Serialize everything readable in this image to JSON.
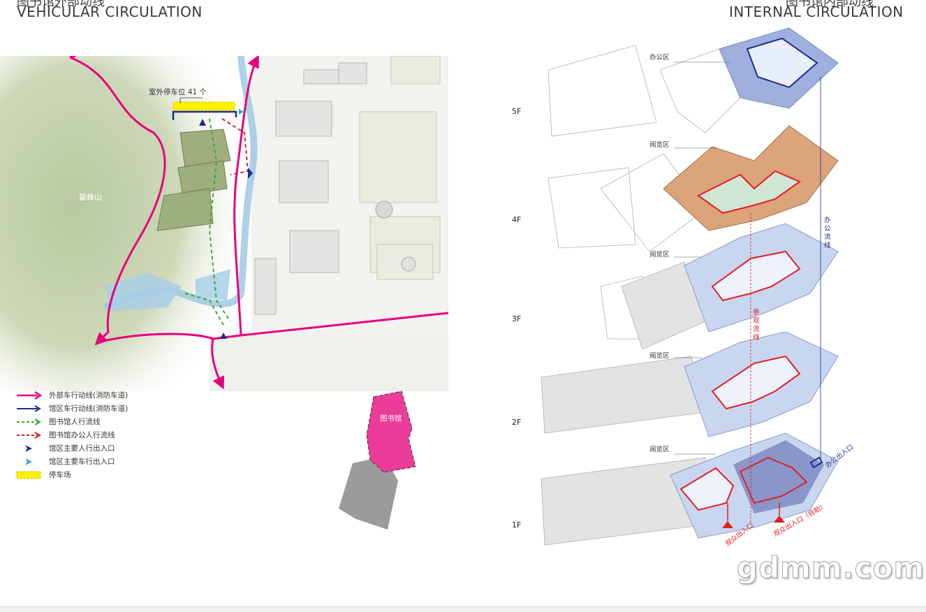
{
  "left_title": {
    "cn": "图书馆外部动线",
    "en": "VEHICULAR CIRCULATION"
  },
  "right_title": {
    "cn": "图书馆内部动线",
    "en": "INTERNAL CIRCULATION"
  },
  "site": {
    "parking_label": "室外停车位 41 个",
    "mountain_label": "鳌峰山"
  },
  "legend": [
    {
      "label": "外部车行动线(消防车道)",
      "icon": "magenta-arrow-line-icon",
      "color": "#e6007e"
    },
    {
      "label": "馆区车行动线(消防车道)",
      "icon": "navy-arrow-line-icon",
      "color": "#1d2f8a"
    },
    {
      "label": "图书馆人行流线",
      "icon": "green-dashed-arrow-icon",
      "color": "#3aa935"
    },
    {
      "label": "图书馆办公人行流线",
      "icon": "red-dashed-arrow-icon",
      "color": "#e02020"
    },
    {
      "label": "馆区主要人行出入口",
      "icon": "navy-entrance-arrow-icon",
      "color": "#1d2f8a"
    },
    {
      "label": "馆区主要车行出入口",
      "icon": "cyan-entrance-arrow-icon",
      "color": "#29a8e0"
    },
    {
      "label": "停车场",
      "icon": "yellow-parking-swatch-icon",
      "color": "#fff200"
    }
  ],
  "key_plan_label": "图书馆",
  "floors": [
    "5F",
    "4F",
    "3F",
    "2F",
    "1F"
  ],
  "zones": {
    "f5": "办公区",
    "f4": "阅览区",
    "f3": "阅览区",
    "f2": "阅览区",
    "f1": "阅览区"
  },
  "flow_labels": {
    "office_flow": "办公流线",
    "visit_flow": "参观流线",
    "office_entrance": "办公出入口",
    "public_entrance": "观众出入口",
    "public_entrance_self": "观众出入口（自助）"
  },
  "colors": {
    "magenta": "#e6007e",
    "navy": "#1d2f8a",
    "red": "#e02020",
    "green": "#3aa935",
    "orange_zone": "#e0a877",
    "blue_zone": "#c9d6f0",
    "dark_blue_zone": "#7d8bc3"
  },
  "watermark": "gdmm.com"
}
